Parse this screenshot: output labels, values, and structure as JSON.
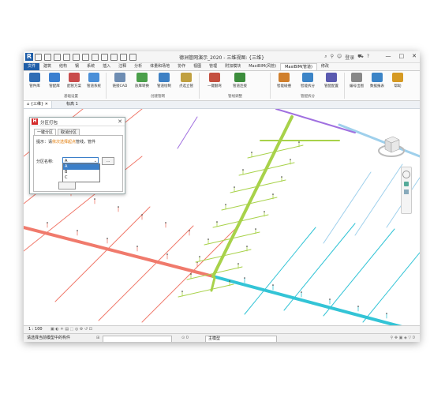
{
  "app": {
    "logo_letter": "R",
    "title": "德洲管网演示_2020 - 三维视图: {三维}",
    "user": "登录",
    "window_controls": [
      "—",
      "□",
      "✕"
    ]
  },
  "tabs": [
    "文件",
    "建筑",
    "结构",
    "钢",
    "系统",
    "插入",
    "注释",
    "分析",
    "体量和场地",
    "协作",
    "视图",
    "管理",
    "附加模块",
    "MaxiBIM(风管)",
    "MaxiBIM(管道)",
    "修改"
  ],
  "active_tab": "MaxiBIM(管道)",
  "ribbon": {
    "buttons": [
      {
        "label": "管件库",
        "color": "#2f6db5"
      },
      {
        "label": "管配库",
        "color": "#3a7fd0"
      },
      {
        "label": "配管方案",
        "color": "#c94b4b"
      },
      {
        "label": "管道系统",
        "color": "#4a8fd8"
      },
      {
        "label": "链接CAD",
        "color": "#6e8db3"
      },
      {
        "label": "族库转换",
        "color": "#4a9f4a"
      },
      {
        "label": "管道绘制",
        "color": "#3d80c4"
      },
      {
        "label": "点选立管",
        "color": "#c0a040"
      },
      {
        "label": "一键翻弯",
        "color": "#c44f3f"
      },
      {
        "label": "管道连接",
        "color": "#3c8d3c"
      },
      {
        "label": "智能碰撞",
        "color": "#d07f2c"
      },
      {
        "label": "智能拆分",
        "color": "#3b84c7"
      },
      {
        "label": "管配配置",
        "color": "#5a5ab0"
      },
      {
        "label": "编号出图",
        "color": "#888"
      },
      {
        "label": "数据报表",
        "color": "#3b84c7"
      },
      {
        "label": "帮助",
        "color": "#d69a23"
      }
    ],
    "groups": [
      "基础设置",
      "创建管网",
      "管线调整",
      "管配拆分"
    ]
  },
  "view_tabs": [
    "{三维}",
    "标高 1"
  ],
  "dialog": {
    "title": "分区打包",
    "tabs": [
      "一键分区",
      "取消分区"
    ],
    "hint_prefix": "提示：请",
    "hint_highlight": "依次选择起点",
    "hint_suffix": "管线，管件",
    "label": "分区名称:",
    "selected": "A",
    "options": [
      "A",
      "B",
      "C"
    ],
    "dots_button": "..."
  },
  "viewbar": {
    "scale": "1 : 100"
  },
  "statusbar": {
    "message": "请选择当前模型中的构件",
    "field": "主模型"
  },
  "colors": {
    "red_pipe": "#f07a6c",
    "green_pipe": "#a8d24a",
    "cyan_pipe": "#33c4d6",
    "lightblue_pipe": "#9fd0ec",
    "purple_pipe": "#a070e0",
    "accent": "#1f5ea8"
  }
}
